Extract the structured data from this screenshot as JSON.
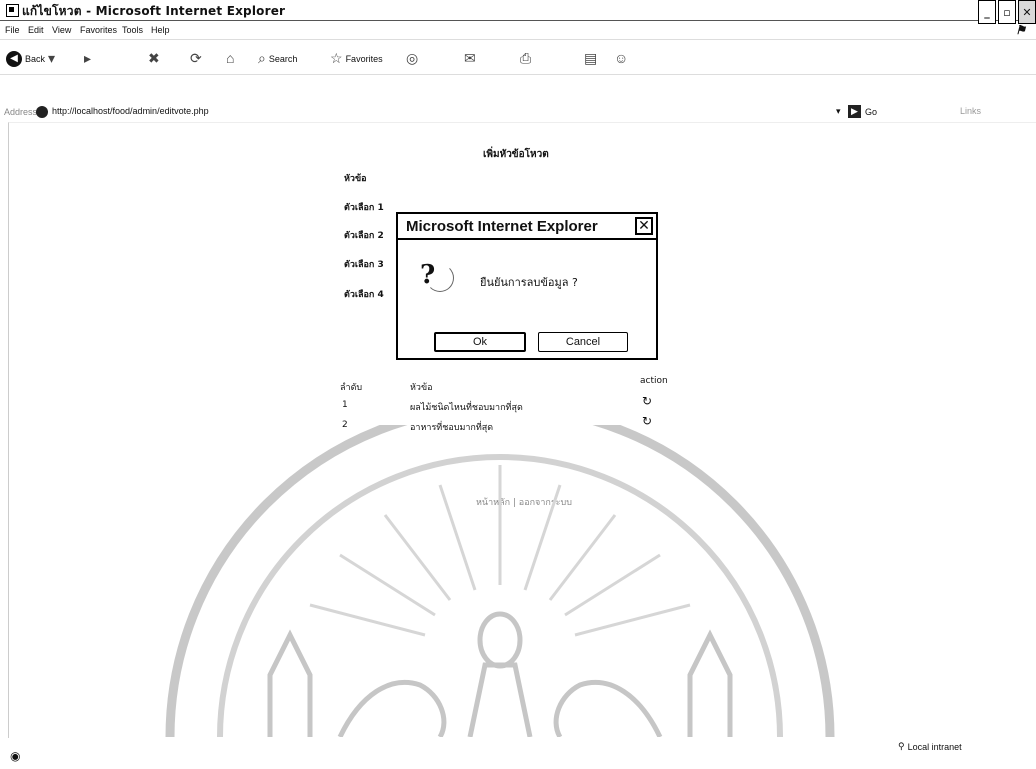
{
  "window": {
    "title": "แก้ไขโหวต - Microsoft Internet Explorer",
    "controls": [
      "_",
      "▫",
      "✕"
    ]
  },
  "menu": {
    "items": [
      "File",
      "Edit",
      "View",
      "Favorites",
      "Tools",
      "Help"
    ]
  },
  "toolbar": {
    "back_label": "Back",
    "search_label": "Search",
    "favorites_label": "Favorites"
  },
  "address": {
    "label": "Address",
    "url": "http://localhost/food/admin/editvote.php",
    "go_label": "Go",
    "links_label": "Links"
  },
  "page": {
    "heading": "เพิ่มหัวข้อโหวต",
    "form_labels": [
      "หัวข้อ",
      "ตัวเลือก 1",
      "ตัวเลือก 2",
      "ตัวเลือก 3",
      "ตัวเลือก 4"
    ],
    "table": {
      "headers": [
        "ลำดับ",
        "หัวข้อ",
        "action"
      ],
      "rows": [
        {
          "no": "1",
          "topic": "ผลไม้ชนิดไหนที่ชอบมากที่สุด"
        },
        {
          "no": "2",
          "topic": "อาหารที่ชอบมากที่สุด"
        }
      ]
    },
    "footer": "หน้าหลัก | ออกจากระบบ"
  },
  "dialog": {
    "title": "Microsoft Internet Explorer",
    "message": "ยืนยันการลบข้อมูล ?",
    "ok_label": "Ok",
    "cancel_label": "Cancel"
  },
  "status": {
    "zone": "Local intranet"
  },
  "icons": {
    "back": "back-arrow-icon",
    "refresh": "refresh-icon",
    "question": "question-icon"
  }
}
